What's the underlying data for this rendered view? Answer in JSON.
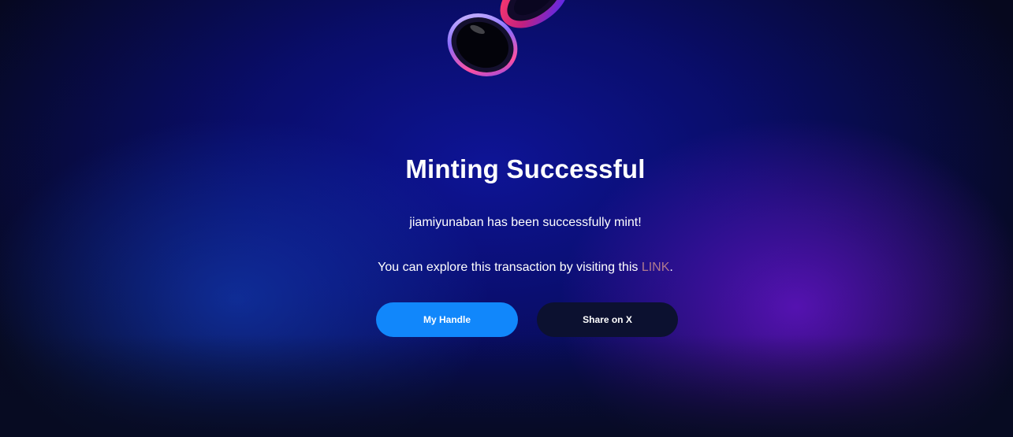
{
  "modal": {
    "title": "Minting Successful",
    "message": "jiamiyunaban has been successfully mint!",
    "explore_prefix": "You can explore this transaction by visiting this ",
    "explore_link": "LINK",
    "explore_suffix": "."
  },
  "buttons": {
    "primary_label": "My Handle",
    "secondary_label": "Share on X"
  },
  "decoration": {
    "icon": "glass-rings-icon"
  },
  "colors": {
    "primary_button": "#1187fb",
    "secondary_button": "#0c1130",
    "link": "#b07a8e",
    "background": "#070b22"
  }
}
